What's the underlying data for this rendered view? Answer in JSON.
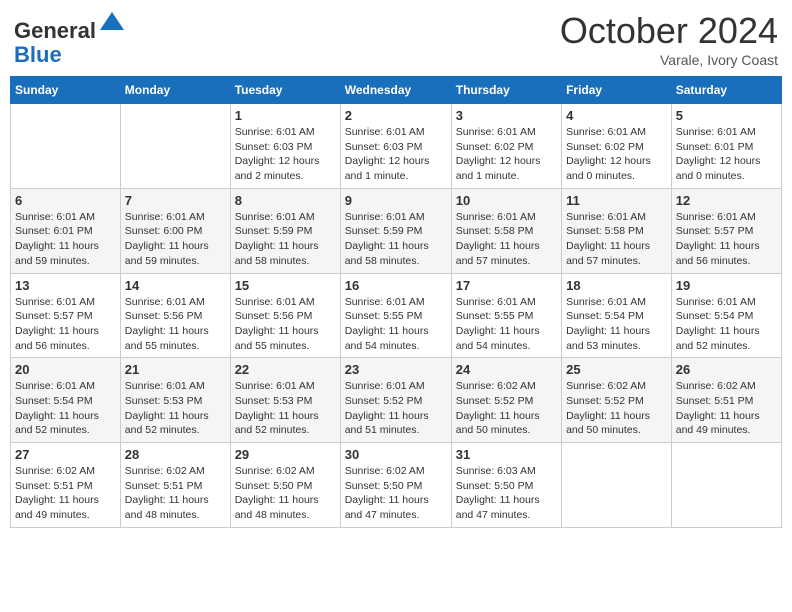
{
  "header": {
    "logo_line1": "General",
    "logo_line2": "Blue",
    "month": "October 2024",
    "location": "Varale, Ivory Coast"
  },
  "weekdays": [
    "Sunday",
    "Monday",
    "Tuesday",
    "Wednesday",
    "Thursday",
    "Friday",
    "Saturday"
  ],
  "weeks": [
    [
      {
        "day": "",
        "info": ""
      },
      {
        "day": "",
        "info": ""
      },
      {
        "day": "1",
        "info": "Sunrise: 6:01 AM\nSunset: 6:03 PM\nDaylight: 12 hours\nand 2 minutes."
      },
      {
        "day": "2",
        "info": "Sunrise: 6:01 AM\nSunset: 6:03 PM\nDaylight: 12 hours\nand 1 minute."
      },
      {
        "day": "3",
        "info": "Sunrise: 6:01 AM\nSunset: 6:02 PM\nDaylight: 12 hours\nand 1 minute."
      },
      {
        "day": "4",
        "info": "Sunrise: 6:01 AM\nSunset: 6:02 PM\nDaylight: 12 hours\nand 0 minutes."
      },
      {
        "day": "5",
        "info": "Sunrise: 6:01 AM\nSunset: 6:01 PM\nDaylight: 12 hours\nand 0 minutes."
      }
    ],
    [
      {
        "day": "6",
        "info": "Sunrise: 6:01 AM\nSunset: 6:01 PM\nDaylight: 11 hours\nand 59 minutes."
      },
      {
        "day": "7",
        "info": "Sunrise: 6:01 AM\nSunset: 6:00 PM\nDaylight: 11 hours\nand 59 minutes."
      },
      {
        "day": "8",
        "info": "Sunrise: 6:01 AM\nSunset: 5:59 PM\nDaylight: 11 hours\nand 58 minutes."
      },
      {
        "day": "9",
        "info": "Sunrise: 6:01 AM\nSunset: 5:59 PM\nDaylight: 11 hours\nand 58 minutes."
      },
      {
        "day": "10",
        "info": "Sunrise: 6:01 AM\nSunset: 5:58 PM\nDaylight: 11 hours\nand 57 minutes."
      },
      {
        "day": "11",
        "info": "Sunrise: 6:01 AM\nSunset: 5:58 PM\nDaylight: 11 hours\nand 57 minutes."
      },
      {
        "day": "12",
        "info": "Sunrise: 6:01 AM\nSunset: 5:57 PM\nDaylight: 11 hours\nand 56 minutes."
      }
    ],
    [
      {
        "day": "13",
        "info": "Sunrise: 6:01 AM\nSunset: 5:57 PM\nDaylight: 11 hours\nand 56 minutes."
      },
      {
        "day": "14",
        "info": "Sunrise: 6:01 AM\nSunset: 5:56 PM\nDaylight: 11 hours\nand 55 minutes."
      },
      {
        "day": "15",
        "info": "Sunrise: 6:01 AM\nSunset: 5:56 PM\nDaylight: 11 hours\nand 55 minutes."
      },
      {
        "day": "16",
        "info": "Sunrise: 6:01 AM\nSunset: 5:55 PM\nDaylight: 11 hours\nand 54 minutes."
      },
      {
        "day": "17",
        "info": "Sunrise: 6:01 AM\nSunset: 5:55 PM\nDaylight: 11 hours\nand 54 minutes."
      },
      {
        "day": "18",
        "info": "Sunrise: 6:01 AM\nSunset: 5:54 PM\nDaylight: 11 hours\nand 53 minutes."
      },
      {
        "day": "19",
        "info": "Sunrise: 6:01 AM\nSunset: 5:54 PM\nDaylight: 11 hours\nand 52 minutes."
      }
    ],
    [
      {
        "day": "20",
        "info": "Sunrise: 6:01 AM\nSunset: 5:54 PM\nDaylight: 11 hours\nand 52 minutes."
      },
      {
        "day": "21",
        "info": "Sunrise: 6:01 AM\nSunset: 5:53 PM\nDaylight: 11 hours\nand 52 minutes."
      },
      {
        "day": "22",
        "info": "Sunrise: 6:01 AM\nSunset: 5:53 PM\nDaylight: 11 hours\nand 52 minutes."
      },
      {
        "day": "23",
        "info": "Sunrise: 6:01 AM\nSunset: 5:52 PM\nDaylight: 11 hours\nand 51 minutes."
      },
      {
        "day": "24",
        "info": "Sunrise: 6:02 AM\nSunset: 5:52 PM\nDaylight: 11 hours\nand 50 minutes."
      },
      {
        "day": "25",
        "info": "Sunrise: 6:02 AM\nSunset: 5:52 PM\nDaylight: 11 hours\nand 50 minutes."
      },
      {
        "day": "26",
        "info": "Sunrise: 6:02 AM\nSunset: 5:51 PM\nDaylight: 11 hours\nand 49 minutes."
      }
    ],
    [
      {
        "day": "27",
        "info": "Sunrise: 6:02 AM\nSunset: 5:51 PM\nDaylight: 11 hours\nand 49 minutes."
      },
      {
        "day": "28",
        "info": "Sunrise: 6:02 AM\nSunset: 5:51 PM\nDaylight: 11 hours\nand 48 minutes."
      },
      {
        "day": "29",
        "info": "Sunrise: 6:02 AM\nSunset: 5:50 PM\nDaylight: 11 hours\nand 48 minutes."
      },
      {
        "day": "30",
        "info": "Sunrise: 6:02 AM\nSunset: 5:50 PM\nDaylight: 11 hours\nand 47 minutes."
      },
      {
        "day": "31",
        "info": "Sunrise: 6:03 AM\nSunset: 5:50 PM\nDaylight: 11 hours\nand 47 minutes."
      },
      {
        "day": "",
        "info": ""
      },
      {
        "day": "",
        "info": ""
      }
    ]
  ]
}
